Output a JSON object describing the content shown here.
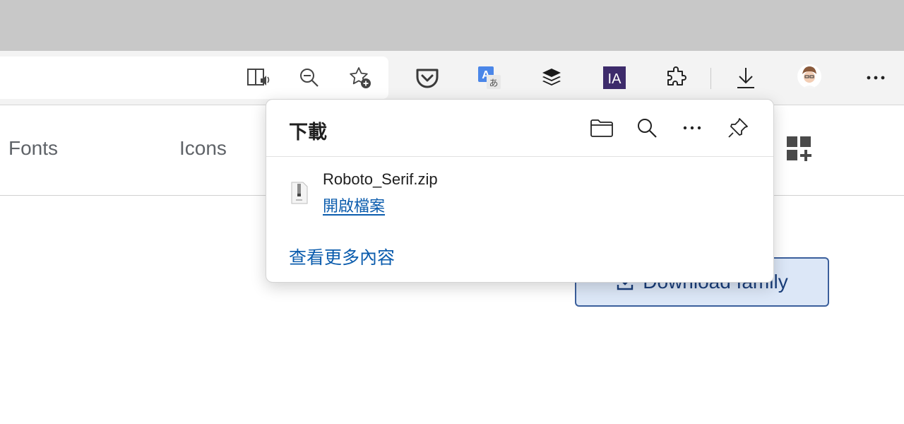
{
  "flyout": {
    "title": "下載",
    "item": {
      "file_name": "Roboto_Serif.zip",
      "open_label": "開啟檔案"
    },
    "see_more_label": "查看更多內容"
  },
  "page": {
    "nav_links": [
      "Fonts",
      "Icons"
    ],
    "download_button_label": "Download family"
  },
  "toolbar": {
    "extension_ia_label": "IA",
    "icons": [
      "read-aloud-icon",
      "zoom-out-icon",
      "add-favorite-icon",
      "pocket-icon",
      "translate-icon",
      "buffer-icon",
      "ia-writer-icon",
      "extensions-icon",
      "downloads-icon",
      "profile-avatar",
      "more-icon"
    ]
  },
  "colors": {
    "link_blue": "#0b5cad",
    "button_border": "#3b5f9c",
    "button_fill": "#dce7f7"
  }
}
